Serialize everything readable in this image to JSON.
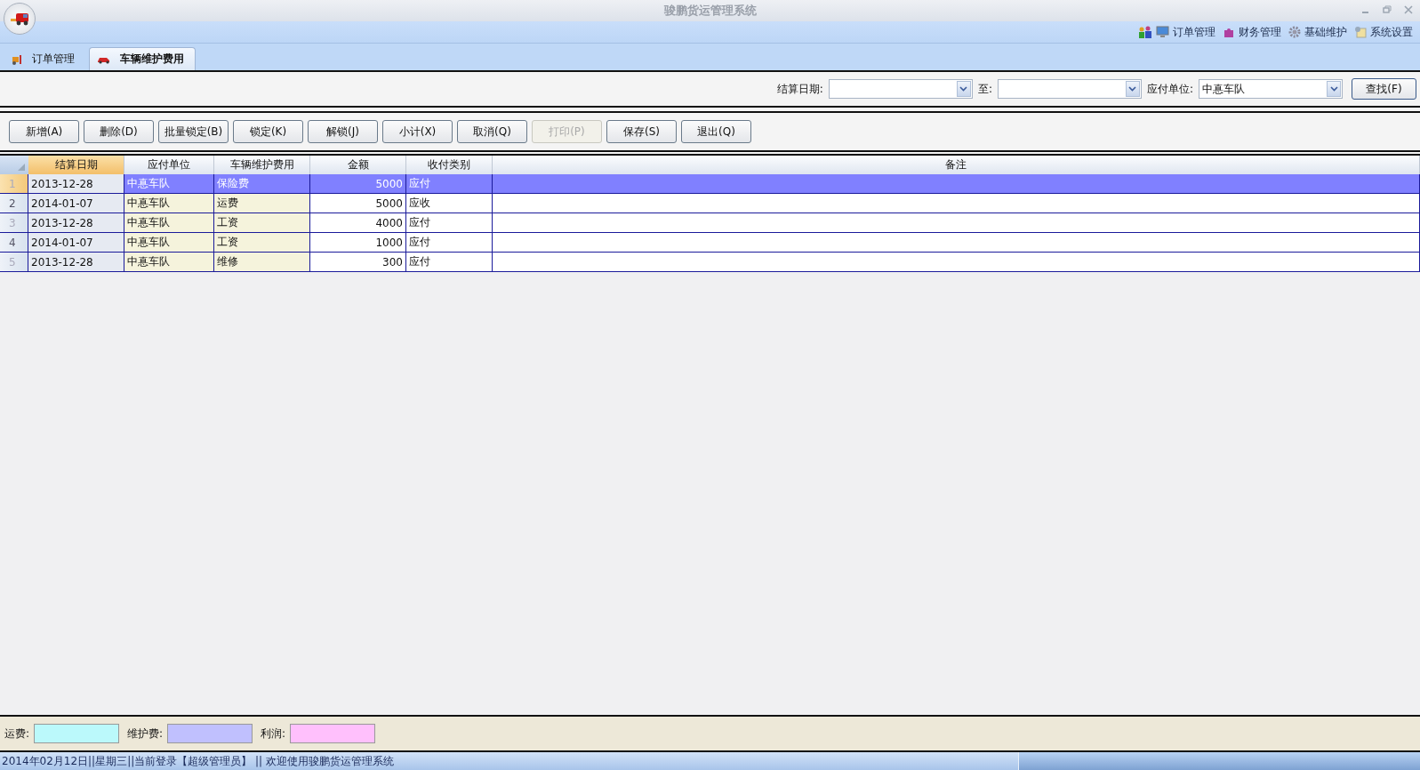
{
  "window": {
    "title": "骏鹏货运管理系统"
  },
  "menu": [
    {
      "label": "订单管理"
    },
    {
      "label": "财务管理"
    },
    {
      "label": "基础维护"
    },
    {
      "label": "系统设置"
    }
  ],
  "tabs": [
    {
      "label": "订单管理",
      "selected": false
    },
    {
      "label": "车辆维护费用",
      "selected": true
    }
  ],
  "filters": {
    "date_from": {
      "label": "结算日期:"
    },
    "date_to": {
      "label": "至:"
    },
    "payee": {
      "label": "应付单位:",
      "value": "中惪车队"
    },
    "search_button": "查找(F)"
  },
  "toolbar": [
    {
      "label": "新增(A)",
      "disabled": false
    },
    {
      "label": "删除(D)",
      "disabled": false
    },
    {
      "label": "批量锁定(B)",
      "disabled": false
    },
    {
      "label": "锁定(K)",
      "disabled": false
    },
    {
      "label": "解锁(J)",
      "disabled": false
    },
    {
      "label": "小计(X)",
      "disabled": false
    },
    {
      "label": "取消(Q)",
      "disabled": false
    },
    {
      "label": "打印(P)",
      "disabled": true
    },
    {
      "label": "保存(S)",
      "disabled": false
    },
    {
      "label": "退出(Q)",
      "disabled": false
    }
  ],
  "table": {
    "columns": [
      {
        "label": "结算日期",
        "selected": true
      },
      {
        "label": "应付单位",
        "selected": false
      },
      {
        "label": "车辆维护费用",
        "selected": false
      },
      {
        "label": "金额",
        "selected": false
      },
      {
        "label": "收付类别",
        "selected": false
      },
      {
        "label": "备注",
        "selected": false
      }
    ],
    "rows": [
      {
        "number": "1",
        "selected": true,
        "cells": [
          "2013-12-28",
          "中惪车队",
          "保险费",
          "5000",
          "应付",
          ""
        ]
      },
      {
        "number": "2",
        "selected": false,
        "cells": [
          "2014-01-07",
          "中惪车队",
          "运费",
          "5000",
          "应收",
          ""
        ]
      },
      {
        "number": "3",
        "selected": false,
        "cells": [
          "2013-12-28",
          "中惪车队",
          "工资",
          "4000",
          "应付",
          ""
        ]
      },
      {
        "number": "4",
        "selected": false,
        "cells": [
          "2014-01-07",
          "中惪车队",
          "工资",
          "1000",
          "应付",
          ""
        ]
      },
      {
        "number": "5",
        "selected": false,
        "cells": [
          "2013-12-28",
          "中惪车队",
          "维修",
          "300",
          "应付",
          ""
        ]
      }
    ]
  },
  "summary": [
    {
      "label": "运费:",
      "color": "#bbf9fb"
    },
    {
      "label": "维护费:",
      "color": "#c0c0fe"
    },
    {
      "label": "利润:",
      "color": "#ffc0fc"
    }
  ],
  "status_bar": "2014年02月12日||星期三||当前登录【超级管理员】 || 欢迎使用骏鹏货运管理系统"
}
